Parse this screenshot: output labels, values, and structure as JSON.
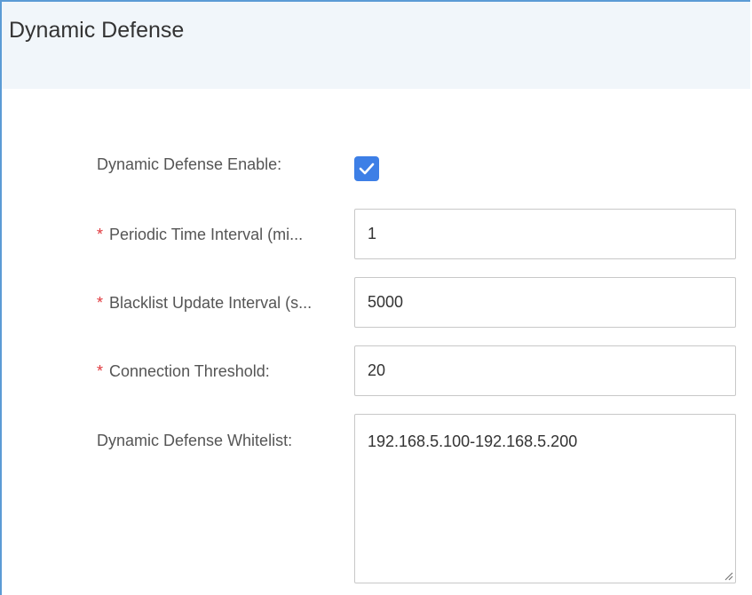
{
  "panel": {
    "title": "Dynamic Defense"
  },
  "form": {
    "enable": {
      "label": "Dynamic Defense Enable:",
      "checked": true,
      "accent_color": "#3d7fe6"
    },
    "periodic_interval": {
      "label": "Periodic Time Interval (mi...",
      "required_mark": "*",
      "value": "1"
    },
    "blacklist_interval": {
      "label": "Blacklist Update Interval (s...",
      "required_mark": "*",
      "value": "5000"
    },
    "connection_threshold": {
      "label": "Connection Threshold:",
      "required_mark": "*",
      "value": "20"
    },
    "whitelist": {
      "label": "Dynamic Defense Whitelist:",
      "value": "192.168.5.100-192.168.5.200"
    }
  },
  "colors": {
    "required": "#e0393e",
    "header_bg": "#f1f6fa",
    "border_accent": "#5b9bd5"
  },
  "icons": {
    "checkbox": "checkmark-icon",
    "textarea_resize": "resize-grip-icon"
  }
}
